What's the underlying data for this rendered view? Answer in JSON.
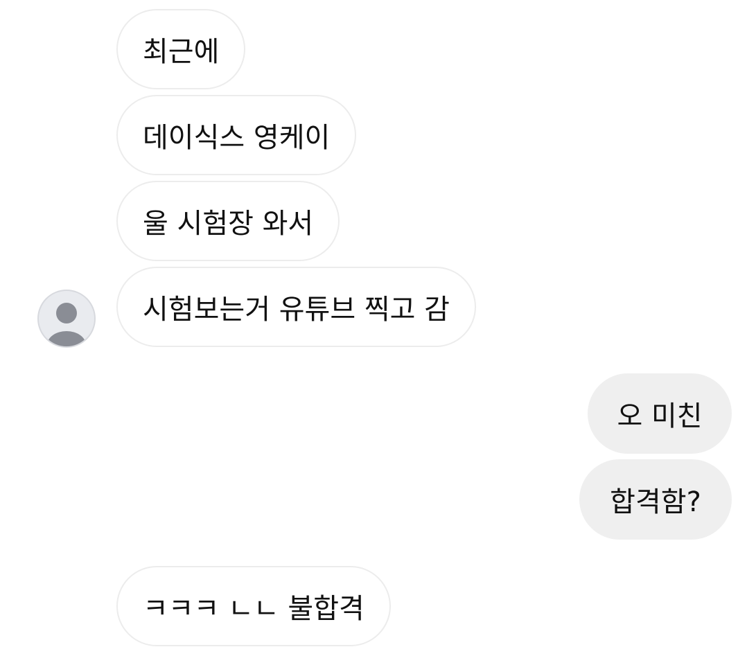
{
  "conversation": {
    "messages": [
      {
        "sender": "them",
        "text": "최근에"
      },
      {
        "sender": "them",
        "text": "데이식스 영케이"
      },
      {
        "sender": "them",
        "text": "울 시험장 와서"
      },
      {
        "sender": "them",
        "text": "시험보는거 유튜브 찍고 감"
      },
      {
        "sender": "me",
        "text": "오 미친"
      },
      {
        "sender": "me",
        "text": "합격함?"
      },
      {
        "sender": "them",
        "text": "ㅋㅋㅋ ㄴㄴ 불합격"
      }
    ],
    "avatar_icon": "default-user-avatar-icon"
  },
  "colors": {
    "incoming_bg": "#ffffff",
    "incoming_border": "#ececec",
    "outgoing_bg": "#efefef",
    "text": "#111111",
    "avatar_bg": "#e9ebef",
    "avatar_figure": "#8a8d95"
  }
}
